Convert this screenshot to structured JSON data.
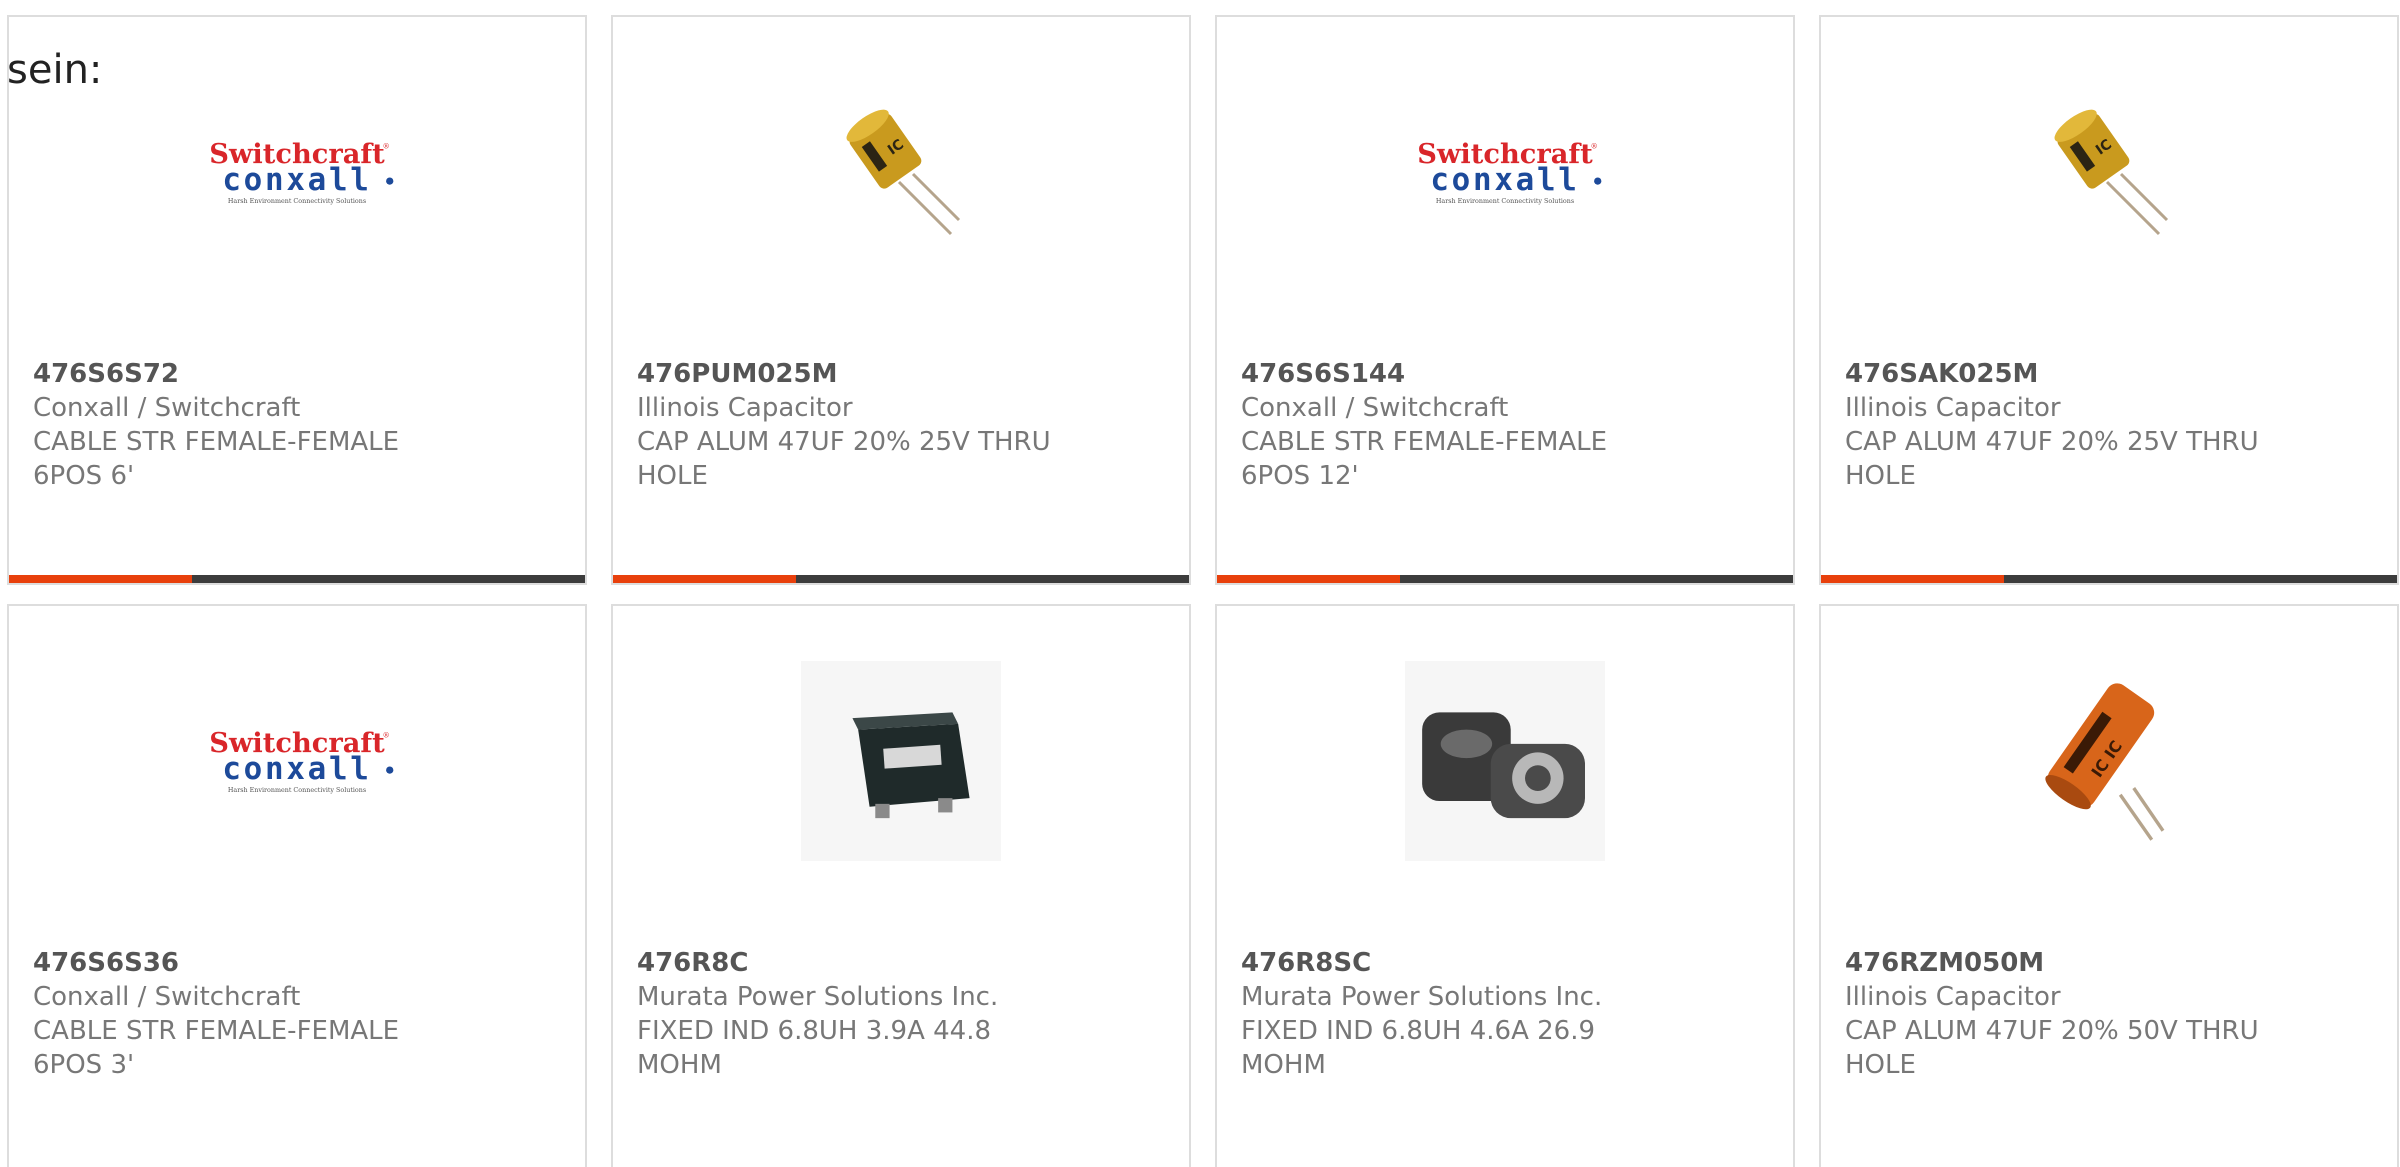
{
  "overlay_text": "sein:",
  "colors": {
    "accent": "#e8400c",
    "bar_track": "#3c3c3c",
    "card_border": "#dddddd",
    "part_number": "#555555",
    "secondary_text": "#777777"
  },
  "products": [
    {
      "part_number": "476S6S72",
      "manufacturer": "Conxall / Switchcraft",
      "description": "CABLE STR FEMALE-FEMALE 6POS 6'",
      "image": "switchcraft-conxall-logo"
    },
    {
      "part_number": "476PUM025M",
      "manufacturer": "Illinois Capacitor",
      "description": "CAP ALUM 47UF 20% 25V THRU HOLE",
      "image": "yellow-radial-capacitor"
    },
    {
      "part_number": "476S6S144",
      "manufacturer": "Conxall / Switchcraft",
      "description": "CABLE STR FEMALE-FEMALE 6POS 12'",
      "image": "switchcraft-conxall-logo"
    },
    {
      "part_number": "476SAK025M",
      "manufacturer": "Illinois Capacitor",
      "description": "CAP ALUM 47UF 20% 25V THRU HOLE",
      "image": "yellow-radial-capacitor"
    },
    {
      "part_number": "476S6S36",
      "manufacturer": "Conxall / Switchcraft",
      "description": "CABLE STR FEMALE-FEMALE 6POS 3'",
      "image": "switchcraft-conxall-logo"
    },
    {
      "part_number": "476R8C",
      "manufacturer": "Murata Power Solutions Inc.",
      "description": "FIXED IND 6.8UH 3.9A 44.8 MOHM",
      "image": "smd-power-inductor"
    },
    {
      "part_number": "476R8SC",
      "manufacturer": "Murata Power Solutions Inc.",
      "description": "FIXED IND 6.8UH 4.6A 26.9 MOHM",
      "image": "shielded-inductor-pair"
    },
    {
      "part_number": "476RZM050M",
      "manufacturer": "Illinois Capacitor",
      "description": "CAP ALUM 47UF 20% 50V THRU HOLE",
      "image": "orange-axial-capacitor"
    }
  ]
}
